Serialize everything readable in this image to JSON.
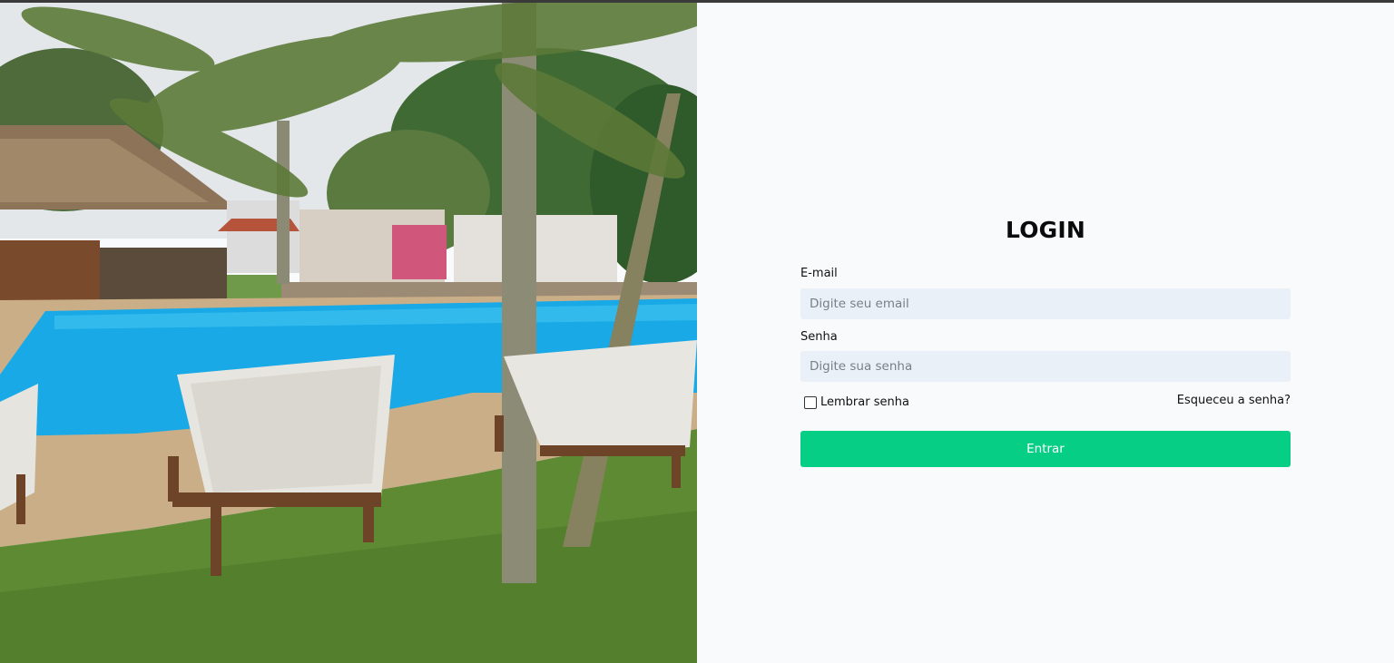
{
  "login": {
    "title": "LOGIN",
    "email_label": "E-mail",
    "email_placeholder": "Digite seu email",
    "email_value": "",
    "password_label": "Senha",
    "password_placeholder": "Digite sua senha",
    "password_value": "",
    "remember_label": "Lembrar senha",
    "remember_checked": false,
    "forgot_link": "Esqueceu a senha?",
    "submit_label": "Entrar"
  },
  "colors": {
    "page_background": "#f9fafb",
    "input_background": "#e9f0f8",
    "submit_button": "#06cf85",
    "text": "#111111"
  },
  "hero": {
    "image": "pool-with-palm-trees-and-lounge-chairs"
  }
}
